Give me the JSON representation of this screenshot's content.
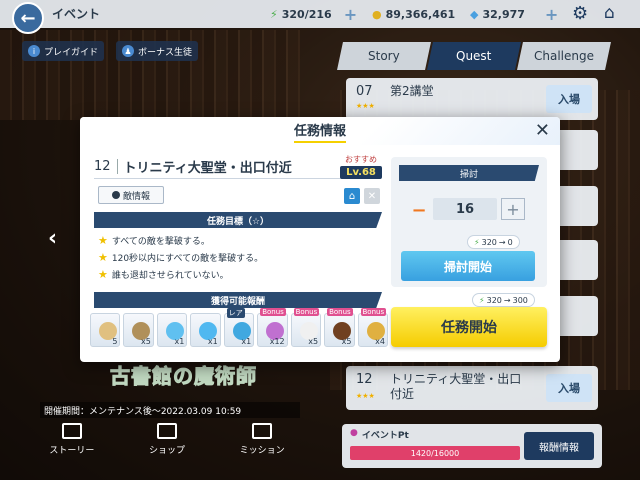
{
  "topbar": {
    "title": "イベント",
    "ap": "320/216",
    "credits": "89,366,461",
    "gems": "32,977"
  },
  "pills": {
    "guide": "プレイガイド",
    "bonus": "ボーナス生徒"
  },
  "tabs": [
    {
      "label": "Story"
    },
    {
      "label": "Quest",
      "active": true
    },
    {
      "label": "Challenge"
    }
  ],
  "stages": [
    {
      "num": "07",
      "name": "第2講堂",
      "enter": "入場"
    },
    {
      "num": "12",
      "name": "トリニティ大聖堂・出口付近",
      "enter": "入場"
    }
  ],
  "event": {
    "period": "開催期間：メンテナンス後〜2022.03.09 10:59",
    "logo": "古書館の魔術師",
    "pt_label": "イベントPt",
    "pt_value": "1420/16000",
    "pt_info": "報酬情報"
  },
  "bottomnav": [
    {
      "label": "ストーリー"
    },
    {
      "label": "ショップ"
    },
    {
      "label": "ミッション"
    }
  ],
  "modal": {
    "title": "任務情報",
    "stage_num": "12",
    "stage_name": "トリニティ大聖堂・出口付近",
    "recommend": "おすすめ",
    "level": "Lv.68",
    "enemy_info": "敵情報",
    "objectives_header": "任務目標（☆）",
    "objectives": [
      "すべての敵を撃破する。",
      "120秒以内にすべての敵を撃破する。",
      "誰も退却させられていない。"
    ],
    "rewards_header": "獲得可能報酬",
    "rewards": [
      {
        "qty": "5",
        "tag": "",
        "color": "#e0c080"
      },
      {
        "qty": "x5",
        "tag": "",
        "color": "#b0905a"
      },
      {
        "qty": "x1",
        "tag": "",
        "color": "#60c0f0"
      },
      {
        "qty": "x1",
        "tag": "",
        "color": "#50b8f0"
      },
      {
        "qty": "x1",
        "tag": "レア",
        "color": "#40a8e0"
      },
      {
        "qty": "x12",
        "tag": "Bonus",
        "color": "#c070d0"
      },
      {
        "qty": "x5",
        "tag": "Bonus",
        "color": "#f0f0f0"
      },
      {
        "qty": "x5",
        "tag": "Bonus",
        "color": "#704020"
      },
      {
        "qty": "x4",
        "tag": "Bonus",
        "color": "#e0b040"
      }
    ],
    "sweep_header": "掃討",
    "sweep_count": "16",
    "sweep_cost_from": "320",
    "sweep_cost_to": "0",
    "sweep_button": "掃討開始",
    "start_cost_from": "320",
    "start_cost_to": "300",
    "start_button": "任務開始"
  },
  "colors": {
    "accent": "#1e3a5f",
    "start": "#f5cc00",
    "sweep": "#38a0e0"
  }
}
